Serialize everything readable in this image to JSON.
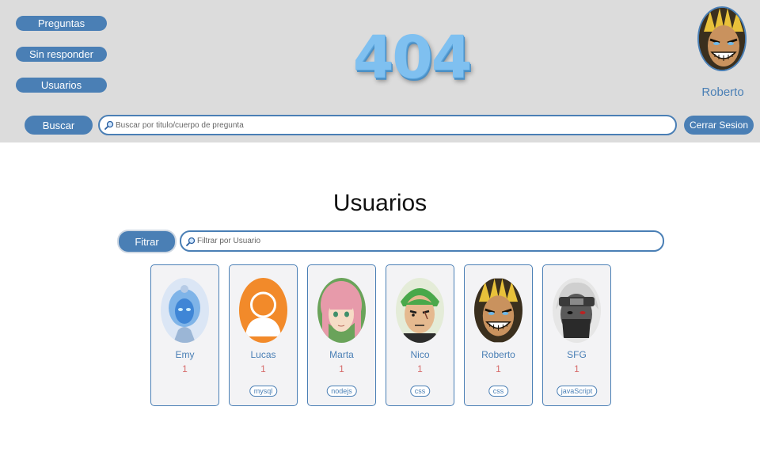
{
  "header": {
    "nav": [
      {
        "label": "Preguntas"
      },
      {
        "label": "Sin responder"
      },
      {
        "label": "Usuarios"
      }
    ],
    "logo_text": "404",
    "profile_name": "Roberto",
    "search_button": "Buscar",
    "search_placeholder": "Buscar por titulo/cuerpo de pregunta",
    "logout_button": "Cerrar Sesion"
  },
  "main": {
    "title": "Usuarios",
    "filter_button": "Fitrar",
    "filter_placeholder": "Filtrar por Usuario",
    "users": [
      {
        "name": "Emy",
        "count": "1",
        "tag": "",
        "avatar": "robot-girl"
      },
      {
        "name": "Lucas",
        "count": "1",
        "tag": "mysql",
        "avatar": "default-person"
      },
      {
        "name": "Marta",
        "count": "1",
        "tag": "nodejs",
        "avatar": "pink-hair-girl"
      },
      {
        "name": "Nico",
        "count": "1",
        "tag": "css",
        "avatar": "green-hair-swordsman"
      },
      {
        "name": "Roberto",
        "count": "1",
        "tag": "css",
        "avatar": "grinning-hero"
      },
      {
        "name": "SFG",
        "count": "1",
        "tag": "javaScript",
        "avatar": "masked-ninja"
      }
    ]
  },
  "colors": {
    "accent": "#4a7fb5",
    "header_bg": "#dcdcdc",
    "count_color": "#d66a6a",
    "logo_color": "#7fc0f0"
  }
}
